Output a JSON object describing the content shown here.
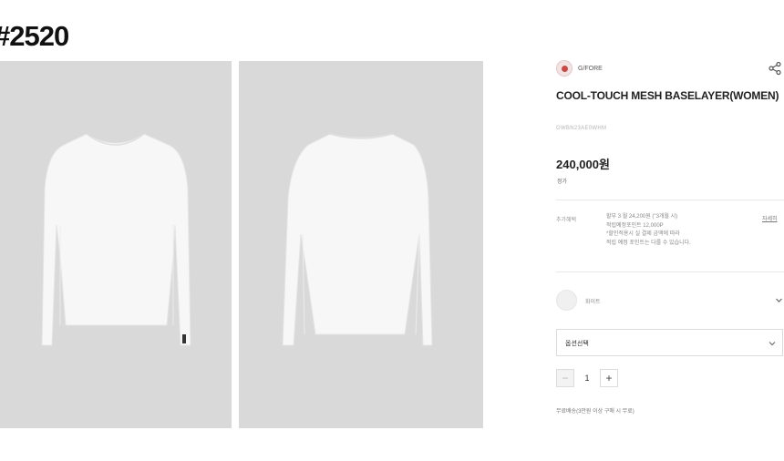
{
  "page": {
    "title": "#2520"
  },
  "gallery": {
    "images": [
      {
        "alt": "front view long sleeve base layer",
        "icon": "shirt-front-image"
      },
      {
        "alt": "back view long sleeve base layer",
        "icon": "shirt-back-image"
      }
    ]
  },
  "product": {
    "brand": "G/FORE",
    "brand_logo_icon": "brand-logo-icon",
    "share_icon": "share-icon",
    "name": "COOL-TOUCH MESH BASELAYER(WOMEN)",
    "code": "GWBN23AE0WHM",
    "price": "240,000원",
    "price_sub": "정가"
  },
  "additional_info": {
    "label": "추가혜택",
    "lines": [
      "할부 3 월 24,200원 (\"3개월 시)",
      "적립예정포인트 12,000P",
      "*할인적용시 실 결제 금액에 따라",
      " 적립 예정 포인트는 다를 수 있습니다."
    ],
    "link": "자세히"
  },
  "color": {
    "name": "화이트",
    "swatch": "#f0f0f0"
  },
  "option": {
    "placeholder": "옵션선택"
  },
  "quantity": {
    "minus": "−",
    "value": "1",
    "plus": "+"
  },
  "shipping": {
    "note": "무료배송(3만원 이상 구매 시 무료)"
  },
  "colors": {
    "photo_bg": "#d9d9d9",
    "shirt": "#f7f7f7"
  }
}
